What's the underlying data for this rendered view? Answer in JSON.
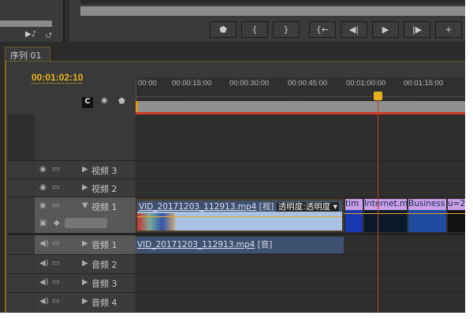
{
  "tab": {
    "label": "序列 01",
    "close": "×"
  },
  "timecode": "00:01:02:10",
  "ruler": {
    "ticks": [
      "00:00",
      "00:00:15:00",
      "00:00:30:00",
      "00:00:45:00",
      "00:01:00:00",
      "00:01:15:00"
    ],
    "playhead_fraction": 0.735
  },
  "monitor_buttons": [
    "add-marker",
    "mark-in",
    "mark-out",
    "go-to-in",
    "step-back",
    "play",
    "step-forward"
  ],
  "tracks": {
    "video": [
      {
        "label": "视频 3"
      },
      {
        "label": "视频 2"
      },
      {
        "label": "视频 1"
      }
    ],
    "audio": [
      {
        "label": "音频 1"
      },
      {
        "label": "音频 2"
      },
      {
        "label": "音频 3"
      },
      {
        "label": "音频 4"
      }
    ]
  },
  "clips": {
    "video_main": {
      "name": "VID_20171203_112913.mp4",
      "tag": "[视]",
      "effect": "透明度:透明度 ▾"
    },
    "video_small": [
      "tim",
      "Internet.m",
      "Business",
      "u=2"
    ],
    "audio_main": {
      "name": "VID_20171203_112913.mp4",
      "tag": "[音]"
    }
  },
  "colors": {
    "timecode": "#e8b21e",
    "playhead": "#d03a2a",
    "video_clip": "#a9c1e2",
    "audio_clip": "#3e5170",
    "small_clip": "#c9a0e8"
  }
}
